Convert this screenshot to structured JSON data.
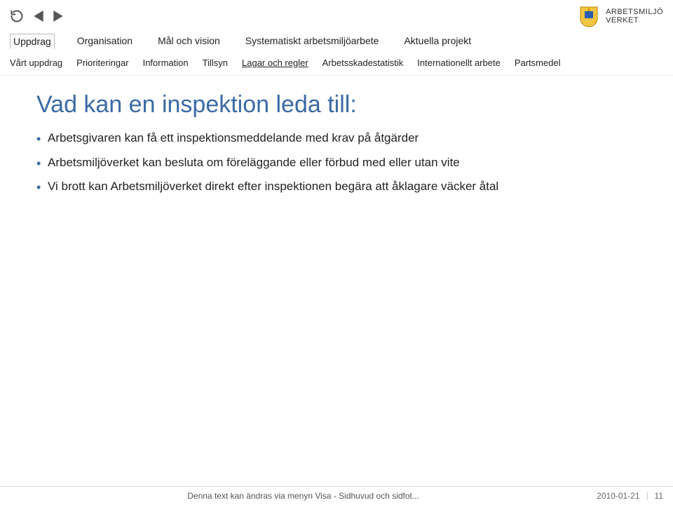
{
  "logo": {
    "line1": "ARBETSMILJÖ",
    "line2": "VERKET"
  },
  "tabs_primary": [
    {
      "label": "Uppdrag",
      "active": true
    },
    {
      "label": "Organisation"
    },
    {
      "label": "Mål och vision"
    },
    {
      "label": "Systematiskt arbetsmiljöarbete"
    },
    {
      "label": "Aktuella projekt"
    }
  ],
  "tabs_secondary": [
    {
      "label": "Vårt uppdrag"
    },
    {
      "label": "Prioriteringar"
    },
    {
      "label": "Information"
    },
    {
      "label": "Tillsyn"
    },
    {
      "label": "Lagar och regler",
      "underline": true
    },
    {
      "label": "Arbetsskadestatistik"
    },
    {
      "label": "Internationellt arbete"
    },
    {
      "label": "Partsmedel"
    }
  ],
  "title": "Vad kan en inspektion leda till:",
  "bullets": [
    "Arbetsgivaren kan få ett inspektionsmeddelande med krav på åtgärder",
    "Arbetsmiljöverket kan besluta om föreläggande eller förbud med eller utan vite",
    "Vi brott kan Arbetsmiljöverket direkt efter inspektionen begära att åklagare väcker åtal"
  ],
  "footer": {
    "note": "Denna text kan ändras via menyn Visa - Sidhuvud och sidfot...",
    "date": "2010-01-21",
    "page": "11"
  }
}
